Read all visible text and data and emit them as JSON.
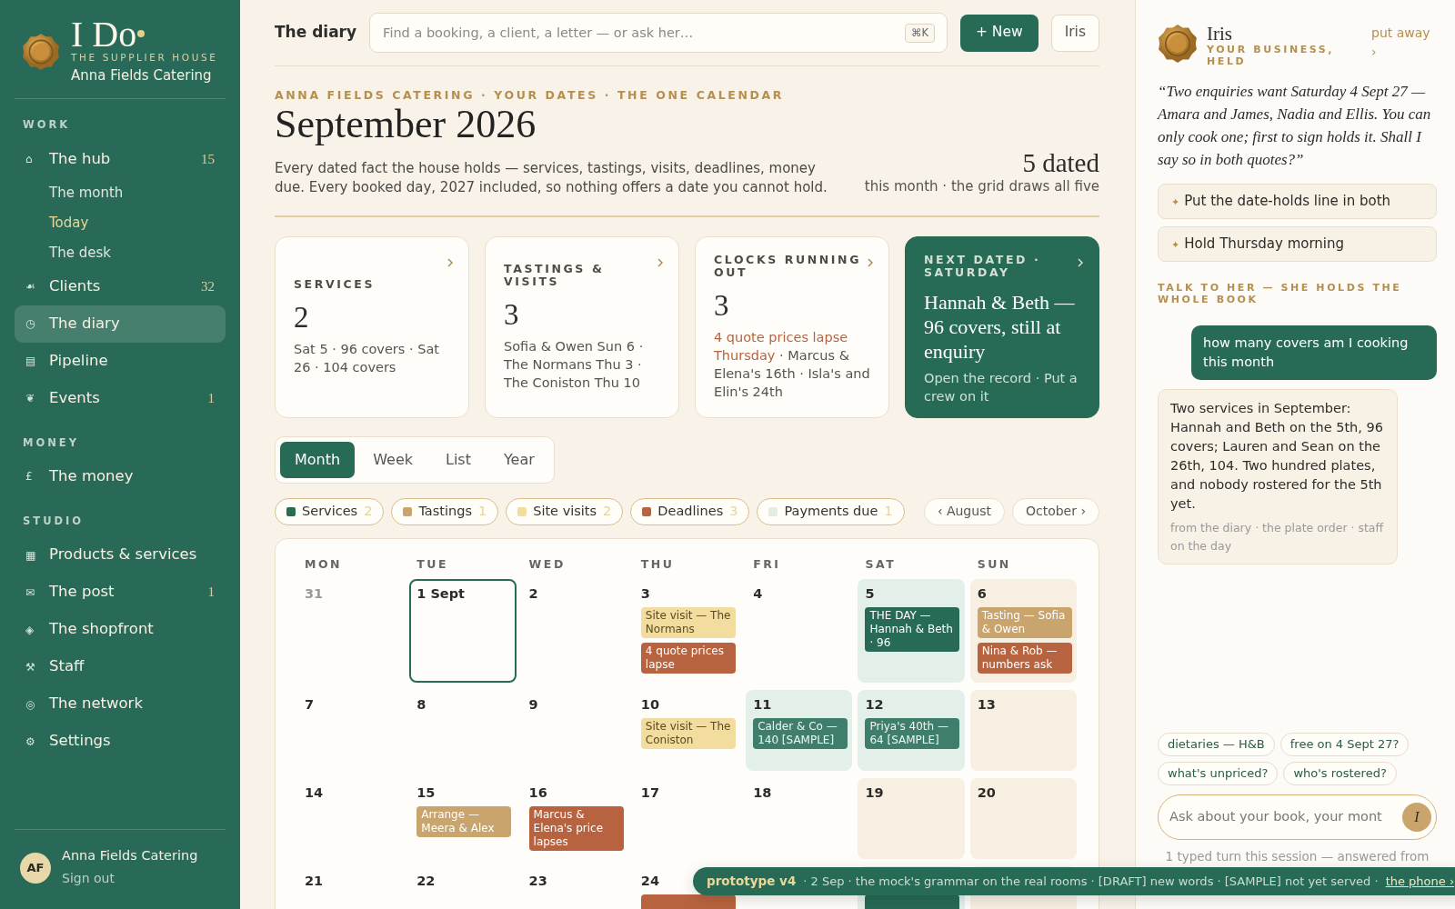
{
  "sidebar": {
    "brand": {
      "logo": "I Do",
      "tagline": "THE SUPPLIER HOUSE",
      "business": "Anna Fields Catering"
    },
    "sections": [
      {
        "heading": "WORK",
        "items": [
          {
            "icon": "⌂",
            "label": "The hub",
            "count": "15",
            "selected": false,
            "children": [
              {
                "label": "The month",
                "highlight": false
              },
              {
                "label": "Today",
                "highlight": true
              },
              {
                "label": "The desk",
                "highlight": false
              }
            ]
          },
          {
            "icon": "☙",
            "label": "Clients",
            "count": "32",
            "selected": false
          },
          {
            "icon": "◷",
            "label": "The diary",
            "selected": true
          },
          {
            "icon": "▤",
            "label": "Pipeline",
            "selected": false
          },
          {
            "icon": "❦",
            "label": "Events",
            "count": "1",
            "selected": false
          }
        ]
      },
      {
        "heading": "MONEY",
        "items": [
          {
            "icon": "£",
            "label": "The money",
            "selected": false
          }
        ]
      },
      {
        "heading": "STUDIO",
        "items": [
          {
            "icon": "▦",
            "label": "Products & services",
            "selected": false
          },
          {
            "icon": "✉",
            "label": "The post",
            "count": "1",
            "selected": false
          },
          {
            "icon": "◈",
            "label": "The shopfront",
            "selected": false
          },
          {
            "icon": "⚒",
            "label": "Staff",
            "selected": false
          },
          {
            "icon": "◎",
            "label": "The network",
            "selected": false
          },
          {
            "icon": "⚙",
            "label": "Settings",
            "selected": false
          }
        ]
      }
    ],
    "user": {
      "initials": "AF",
      "name": "Anna Fields Catering",
      "action": "Sign out"
    }
  },
  "topbar": {
    "title": "The diary",
    "search": {
      "placeholder": "Find a booking, a client, a letter — or ask her…",
      "shortcut": "⌘K"
    },
    "buttons": [
      {
        "label": "+ New",
        "kind": "primary"
      },
      {
        "label": "Iris",
        "kind": "outline"
      }
    ]
  },
  "header": {
    "eyebrow": "ANNA FIELDS CATERING · YOUR DATES · THE ONE CALENDAR",
    "title": "September 2026",
    "description": "Every dated fact the house holds — services, tastings, visits, deadlines, money due. Every booked day, 2027 included, so nothing offers a date you cannot hold.",
    "count": "5 dated",
    "count_note": "this month · the grid draws all five"
  },
  "cards": [
    {
      "kind": "stat",
      "label": "SERVICES",
      "value": "2",
      "text": "Sat 5 · 96 covers · Sat 26 · 104 covers"
    },
    {
      "kind": "stat",
      "label": "TASTINGS & VISITS",
      "value": "3",
      "text": "Sofia & Owen Sun 6 · The Normans Thu 3 · The Coniston Thu 10"
    },
    {
      "kind": "stat",
      "label": "CLOCKS RUNNING OUT",
      "value": "3",
      "alert": "4 quote prices lapse Thursday",
      "text": "· Marcus & Elena's 16th · Isla's and Elin's 24th"
    },
    {
      "kind": "feature",
      "label": "NEXT DATED · SATURDAY",
      "headline": "Hannah & Beth — 96 covers, still at enquiry",
      "text": "Open the record · Put a crew on it"
    }
  ],
  "views": [
    {
      "label": "Month",
      "selected": true
    },
    {
      "label": "Week",
      "selected": false
    },
    {
      "label": "List",
      "selected": false
    },
    {
      "label": "Year",
      "selected": false
    }
  ],
  "legend": [
    {
      "label": "Services",
      "count": "2",
      "color": "#276a56"
    },
    {
      "label": "Tastings",
      "count": "1",
      "color": "#c9a46d"
    },
    {
      "label": "Site visits",
      "count": "2",
      "color": "#f2dc9e"
    },
    {
      "label": "Deadlines",
      "count": "3",
      "color": "#b8633f"
    },
    {
      "label": "Payments due",
      "count": "1",
      "color": "#e4ebe6"
    }
  ],
  "month_nav": [
    "‹ August",
    "October ›"
  ],
  "calendar": {
    "weekdays": [
      "MON",
      "TUE",
      "WED",
      "THU",
      "FRI",
      "SAT",
      "SUN"
    ],
    "weeks": [
      [
        {
          "label": "31",
          "muted": true,
          "today": false,
          "kind": "plain"
        },
        {
          "label": "1 Sept",
          "muted": false,
          "today": true,
          "kind": "plain"
        },
        {
          "label": "2",
          "muted": false,
          "today": false,
          "kind": "plain"
        },
        {
          "label": "3",
          "muted": false,
          "today": false,
          "kind": "plain",
          "events": [
            {
              "kind": "visit",
              "text": "Site visit — The Normans"
            },
            {
              "kind": "deadline",
              "text": "4 quote prices lapse"
            }
          ]
        },
        {
          "label": "4",
          "muted": false,
          "today": false,
          "kind": "plain"
        },
        {
          "label": "5",
          "muted": false,
          "today": false,
          "kind": "service",
          "events": [
            {
              "kind": "service",
              "text": "THE DAY — Hannah & Beth · 96"
            }
          ]
        },
        {
          "label": "6",
          "muted": false,
          "today": false,
          "kind": "weekend",
          "events": [
            {
              "kind": "tasting",
              "text": "Tasting — Sofia & Owen"
            },
            {
              "kind": "deadline",
              "text": "Nina & Rob — numbers ask"
            }
          ]
        }
      ],
      [
        {
          "label": "7",
          "muted": false,
          "today": false,
          "kind": "plain"
        },
        {
          "label": "8",
          "muted": false,
          "today": false,
          "kind": "plain"
        },
        {
          "label": "9",
          "muted": false,
          "today": false,
          "kind": "plain"
        },
        {
          "label": "10",
          "muted": false,
          "today": false,
          "kind": "plain",
          "events": [
            {
              "kind": "visit",
              "text": "Site visit — The Coniston"
            }
          ]
        },
        {
          "label": "11",
          "muted": false,
          "today": false,
          "kind": "service",
          "events": [
            {
              "kind": "sample",
              "text": "Calder & Co — 140 [SAMPLE]"
            }
          ]
        },
        {
          "label": "12",
          "muted": false,
          "today": false,
          "kind": "service",
          "events": [
            {
              "kind": "sample",
              "text": "Priya's 40th — 64 [SAMPLE]"
            }
          ]
        },
        {
          "label": "13",
          "muted": false,
          "today": false,
          "kind": "weekend"
        }
      ],
      [
        {
          "label": "14",
          "muted": false,
          "today": false,
          "kind": "plain"
        },
        {
          "label": "15",
          "muted": false,
          "today": false,
          "kind": "plain",
          "events": [
            {
              "kind": "tasting",
              "text": "Arrange — Meera & Alex"
            }
          ]
        },
        {
          "label": "16",
          "muted": false,
          "today": false,
          "kind": "plain",
          "events": [
            {
              "kind": "deadline",
              "text": "Marcus & Elena's price lapses"
            }
          ]
        },
        {
          "label": "17",
          "muted": false,
          "today": false,
          "kind": "plain"
        },
        {
          "label": "18",
          "muted": false,
          "today": false,
          "kind": "plain"
        },
        {
          "label": "19",
          "muted": false,
          "today": false,
          "kind": "weekend"
        },
        {
          "label": "20",
          "muted": false,
          "today": false,
          "kind": "weekend"
        }
      ],
      [
        {
          "label": "21",
          "muted": false,
          "today": false,
          "kind": "plain"
        },
        {
          "label": "22",
          "muted": false,
          "today": false,
          "kind": "plain"
        },
        {
          "label": "23",
          "muted": false,
          "today": false,
          "kind": "plain"
        },
        {
          "label": "24",
          "muted": false,
          "today": false,
          "kind": "plain",
          "events": [
            {
              "kind": "deadline"
            }
          ]
        },
        {
          "kind": "plain"
        },
        {
          "kind": "service",
          "events": [
            {
              "kind": "service"
            }
          ]
        },
        {
          "kind": "weekend"
        }
      ]
    ]
  },
  "iris": {
    "name": "Iris",
    "subtitle": "YOUR BUSINESS, HELD",
    "dismiss": "put away ›",
    "quote": "“Two enquiries want Saturday 4 Sept 27 — Amara and James, Nadia and Ellis. You can only cook one; first to sign holds it. Shall I say so in both quotes?”",
    "suggestions": [
      {
        "icon": "✦",
        "label": "Put the date-holds line in both"
      },
      {
        "icon": "✦",
        "label": "Hold Thursday morning"
      }
    ],
    "section_label": "TALK TO HER — SHE HOLDS THE WHOLE BOOK",
    "messages": [
      {
        "kind": "user",
        "text": "how many covers am I cooking this month"
      },
      {
        "kind": "assistant",
        "text": "Two services in September: Hannah and Beth on the 5th, 96 covers; Lauren and Sean on the 26th, 104. Two hundred plates, and nobody rostered for the 5th yet.",
        "source": "from the diary · the plate order · staff on the day"
      }
    ],
    "chips": [
      "dietaries — H&B",
      "free on 4 Sept 27?",
      "what's unpriced?",
      "who's rostered?"
    ],
    "input": {
      "placeholder": "Ask about your book, your mont",
      "send": "I"
    },
    "footer": "1 typed turn this session — answered from"
  },
  "banner": {
    "version": "prototype v4",
    "text": "· 2 Sep · the mock's grammar on the real rooms · [DRAFT] new words · [SAMPLE] not yet served ·",
    "link": "the phone ›"
  }
}
